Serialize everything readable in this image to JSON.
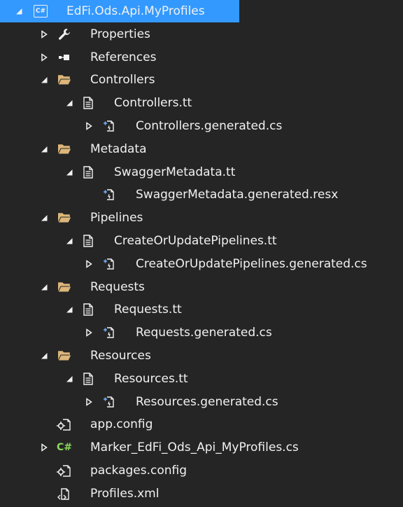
{
  "tree": [
    {
      "label": "EdFi.Ods.Api.MyProfiles",
      "level": 0,
      "expander": "expanded",
      "icon": "csharp-project-icon",
      "selected": true
    },
    {
      "label": "Properties",
      "level": 1,
      "expander": "collapsed",
      "icon": "wrench-icon"
    },
    {
      "label": "References",
      "level": 1,
      "expander": "collapsed",
      "icon": "references-icon"
    },
    {
      "label": "Controllers",
      "level": 1,
      "expander": "expanded",
      "icon": "folder-open-icon"
    },
    {
      "label": "Controllers.tt",
      "level": 2,
      "expander": "expanded",
      "icon": "text-template-icon"
    },
    {
      "label": "Controllers.generated.cs",
      "level": 3,
      "expander": "collapsed",
      "icon": "generated-file-icon"
    },
    {
      "label": "Metadata",
      "level": 1,
      "expander": "expanded",
      "icon": "folder-open-icon"
    },
    {
      "label": "SwaggerMetadata.tt",
      "level": 2,
      "expander": "expanded",
      "icon": "text-template-icon"
    },
    {
      "label": "SwaggerMetadata.generated.resx",
      "level": 3,
      "expander": "none",
      "icon": "generated-file-icon"
    },
    {
      "label": "Pipelines",
      "level": 1,
      "expander": "expanded",
      "icon": "folder-open-icon"
    },
    {
      "label": "CreateOrUpdatePipelines.tt",
      "level": 2,
      "expander": "expanded",
      "icon": "text-template-icon"
    },
    {
      "label": "CreateOrUpdatePipelines.generated.cs",
      "level": 3,
      "expander": "collapsed",
      "icon": "generated-file-icon"
    },
    {
      "label": "Requests",
      "level": 1,
      "expander": "expanded",
      "icon": "folder-open-icon"
    },
    {
      "label": "Requests.tt",
      "level": 2,
      "expander": "expanded",
      "icon": "text-template-icon"
    },
    {
      "label": "Requests.generated.cs",
      "level": 3,
      "expander": "collapsed",
      "icon": "generated-file-icon"
    },
    {
      "label": "Resources",
      "level": 1,
      "expander": "expanded",
      "icon": "folder-open-icon"
    },
    {
      "label": "Resources.tt",
      "level": 2,
      "expander": "expanded",
      "icon": "text-template-icon"
    },
    {
      "label": "Resources.generated.cs",
      "level": 3,
      "expander": "collapsed",
      "icon": "generated-file-icon"
    },
    {
      "label": "app.config",
      "level": 1,
      "expander": "none",
      "icon": "config-file-icon"
    },
    {
      "label": "Marker_EdFi_Ods_Api_MyProfiles.cs",
      "level": 1,
      "expander": "collapsed",
      "icon": "csharp-file-icon"
    },
    {
      "label": "packages.config",
      "level": 1,
      "expander": "none",
      "icon": "config-file-icon"
    },
    {
      "label": "Profiles.xml",
      "level": 1,
      "expander": "none",
      "icon": "xml-file-icon"
    }
  ],
  "icon_badges": {
    "csharp_project": "C#",
    "csharp_file": "C#"
  },
  "colors": {
    "background": "#252526",
    "selection": "#3399ff",
    "text": "#f1f1f1",
    "folder": "#dcb67a",
    "csharp_green": "#8bd95b"
  }
}
